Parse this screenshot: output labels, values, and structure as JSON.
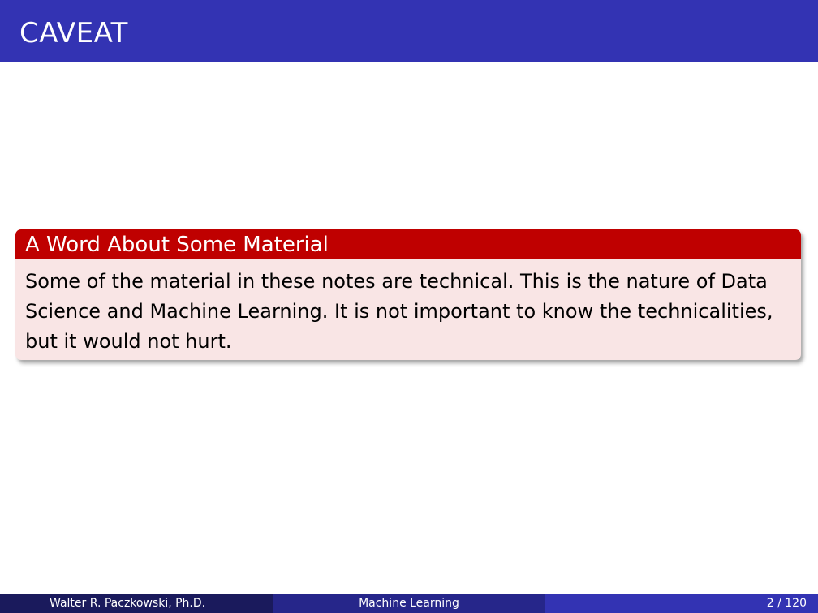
{
  "slide": {
    "title": "CAVEAT"
  },
  "block": {
    "title": "A Word About Some Material",
    "body": "Some of the material in these notes are technical. This is the nature of Data Science and Machine Learning. It is not important to know the technicalities, but it would not hurt."
  },
  "footer": {
    "author": "Walter R. Paczkowski, Ph.D.",
    "presentation_title": "Machine Learning",
    "page_number": "2 / 120"
  },
  "colors": {
    "title_bar": "#3333b3",
    "block_header": "#bf0000",
    "block_body": "#f9e5e5",
    "footer_left": "#1a1a5c",
    "footer_center": "#26268a",
    "footer_right": "#3333b3"
  }
}
